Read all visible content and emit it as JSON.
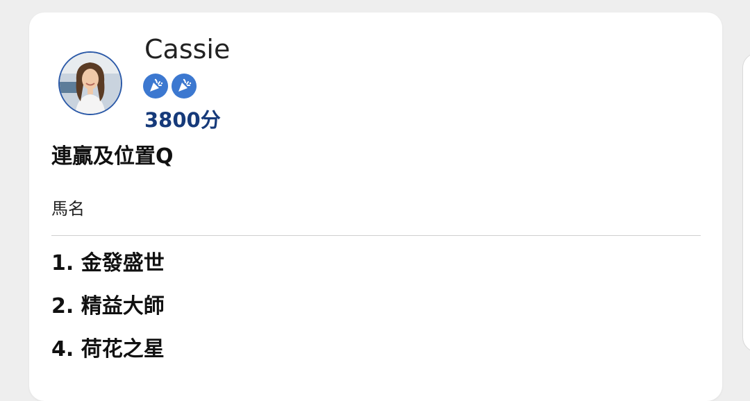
{
  "user": {
    "name": "Cassie",
    "score": "3800分",
    "badges": [
      {
        "icon": "party-popper-icon"
      },
      {
        "icon": "party-popper-icon"
      }
    ]
  },
  "section": {
    "title": "連贏及位置Q",
    "column_header": "馬名"
  },
  "picks": [
    {
      "text": "1. 金發盛世"
    },
    {
      "text": "2. 精益大師"
    },
    {
      "text": "4. 荷花之星"
    }
  ],
  "colors": {
    "accent": "#163a7a",
    "badge": "#3c78d0",
    "avatar_border": "#2c5aa8"
  }
}
